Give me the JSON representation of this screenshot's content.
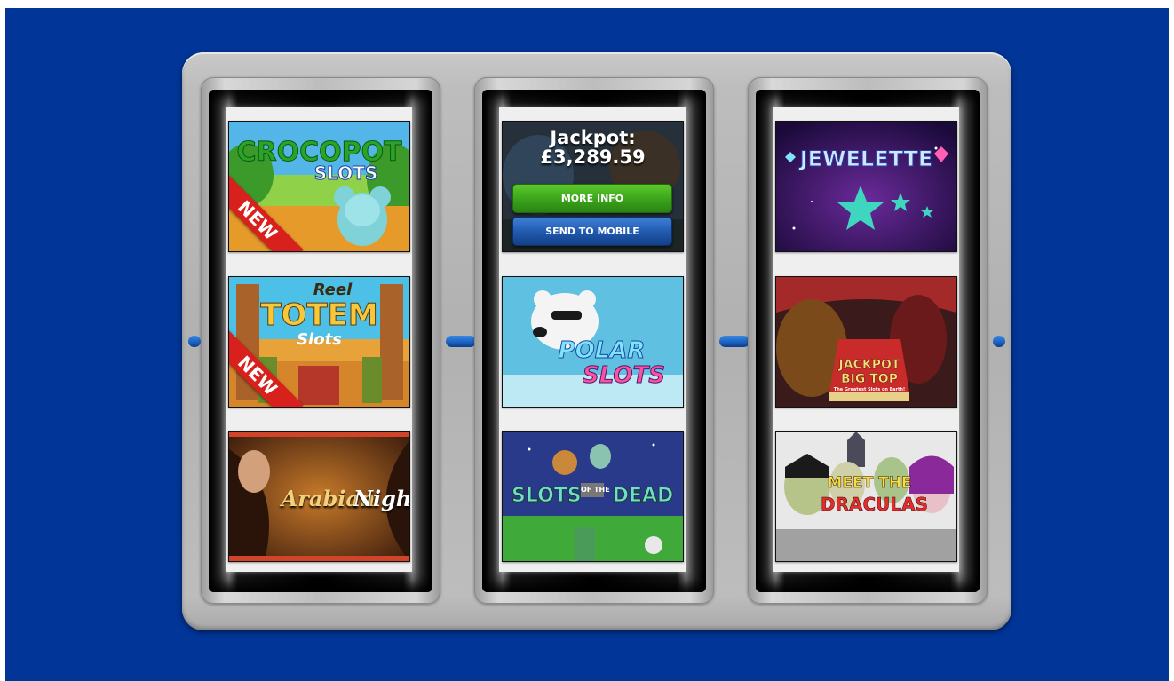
{
  "colors": {
    "background": "#013597",
    "machine": "#b8b8b8",
    "rail": "#1f66c6",
    "more_info_button": "#3aa31a",
    "send_to_mobile_button": "#1f58ad",
    "new_ribbon": "#d8201c"
  },
  "reels": [
    {
      "games": [
        {
          "logo_line1": "CROCOPOT",
          "logo_line2": "SLOTS",
          "badge": "NEW"
        },
        {
          "logo_line1": "Reel",
          "logo_line2": "TOTEM",
          "logo_line3": "Slots",
          "badge": "NEW"
        },
        {
          "logo_line1": "Arabian",
          "logo_line2": "Nights"
        }
      ]
    },
    {
      "games": [
        {
          "jackpot_label": "Jackpot:",
          "jackpot_amount": "£3,289.59",
          "more_info_label": "MORE INFO",
          "send_to_mobile_label": "SEND TO MOBILE"
        },
        {
          "logo_line1": "POLAR",
          "logo_line2": "SLOTS"
        },
        {
          "logo_line1": "SLOTS",
          "logo_line2": "OF THE",
          "logo_line3": "DEAD"
        }
      ]
    },
    {
      "games": [
        {
          "logo_line1": "JEWELETTE"
        },
        {
          "logo_line1": "JACKPOT",
          "logo_line2": "BIG TOP",
          "logo_line3": "The Greatest Slots on Earth!"
        },
        {
          "logo_line1": "MEET THE",
          "logo_line2": "DRACULAS"
        }
      ]
    }
  ]
}
